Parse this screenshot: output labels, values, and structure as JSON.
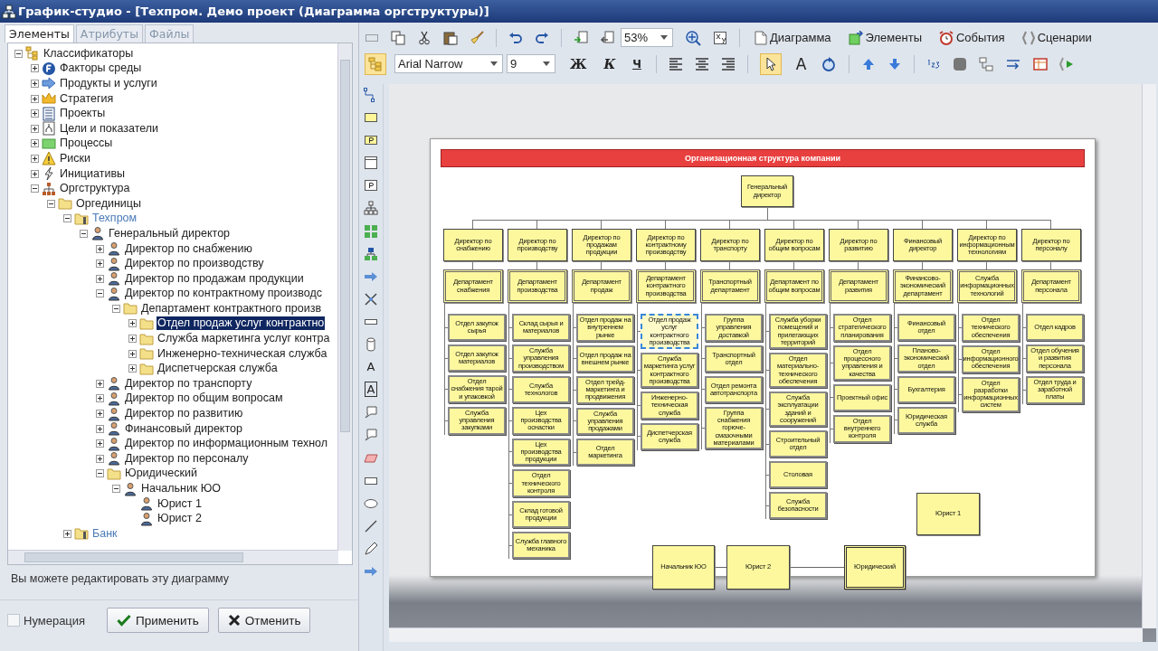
{
  "window": {
    "title": "График-студио - [Техпром. Демо проект (Диаграмма оргструктуры)]"
  },
  "left_panel": {
    "tabs": [
      {
        "label": "Элементы",
        "selected": true
      },
      {
        "label": "Атрибуты",
        "selected": false
      },
      {
        "label": "Файлы",
        "selected": false
      }
    ],
    "tree": [
      {
        "label": "Классификаторы",
        "kind": "classifier",
        "expanded": true,
        "selected": false,
        "children": [
          {
            "label": "Факторы среды",
            "kind": "factor",
            "expanded": false,
            "selected": false
          },
          {
            "label": "Продукты и услуги",
            "kind": "product",
            "expanded": false,
            "selected": false
          },
          {
            "label": "Стратегия",
            "kind": "strategy",
            "expanded": false,
            "selected": false
          },
          {
            "label": "Проекты",
            "kind": "project",
            "expanded": false,
            "selected": false
          },
          {
            "label": "Цели и показатели",
            "kind": "goal",
            "expanded": false,
            "selected": false
          },
          {
            "label": "Процессы",
            "kind": "process",
            "expanded": false,
            "selected": false
          },
          {
            "label": "Риски",
            "kind": "risk",
            "expanded": false,
            "selected": false
          },
          {
            "label": "Инициативы",
            "kind": "initiative",
            "expanded": false,
            "selected": false
          },
          {
            "label": "Оргструктура",
            "kind": "org",
            "expanded": true,
            "selected": false,
            "children": [
              {
                "label": "Оргединицы",
                "kind": "folder",
                "expanded": true,
                "selected": false,
                "children": [
                  {
                    "label": "Техпром",
                    "kind": "company",
                    "expanded": true,
                    "selected": false,
                    "children": [
                      {
                        "label": "Генеральный директор",
                        "kind": "person",
                        "expanded": true,
                        "selected": false,
                        "children": [
                          {
                            "label": "Директор по снабжению",
                            "kind": "person",
                            "expanded": false,
                            "selected": false
                          },
                          {
                            "label": "Директор по производству",
                            "kind": "person",
                            "expanded": false,
                            "selected": false
                          },
                          {
                            "label": "Директор по продажам продукции",
                            "kind": "person",
                            "expanded": false,
                            "selected": false
                          },
                          {
                            "label": "Директор по контрактному производс",
                            "kind": "person",
                            "expanded": true,
                            "selected": false,
                            "children": [
                              {
                                "label": "Департамент контрактного произв",
                                "kind": "folder",
                                "expanded": true,
                                "selected": false,
                                "children": [
                                  {
                                    "label": "Отдел продаж услуг контрактно",
                                    "kind": "folder",
                                    "expanded": false,
                                    "selected": true
                                  },
                                  {
                                    "label": "Служба маркетинга услуг контра",
                                    "kind": "folder",
                                    "expanded": false,
                                    "selected": false
                                  },
                                  {
                                    "label": "Инженерно-техническая служба",
                                    "kind": "folder",
                                    "expanded": false,
                                    "selected": false
                                  },
                                  {
                                    "label": "Диспетчерская служба",
                                    "kind": "folder",
                                    "expanded": false,
                                    "selected": false
                                  }
                                ]
                              }
                            ]
                          },
                          {
                            "label": "Директор по транспорту",
                            "kind": "person",
                            "expanded": false,
                            "selected": false
                          },
                          {
                            "label": "Директор по общим вопросам",
                            "kind": "person",
                            "expanded": false,
                            "selected": false
                          },
                          {
                            "label": "Директор по развитию",
                            "kind": "person",
                            "expanded": false,
                            "selected": false
                          },
                          {
                            "label": "Финансовый директор",
                            "kind": "person",
                            "expanded": false,
                            "selected": false
                          },
                          {
                            "label": "Директор по информационным технол",
                            "kind": "person",
                            "expanded": false,
                            "selected": false
                          },
                          {
                            "label": "Директор по персоналу",
                            "kind": "person",
                            "expanded": false,
                            "selected": false
                          },
                          {
                            "label": "Юридический",
                            "kind": "folder",
                            "expanded": true,
                            "selected": false,
                            "children": [
                              {
                                "label": "Начальник ЮО",
                                "kind": "person",
                                "expanded": true,
                                "selected": false,
                                "children": [
                                  {
                                    "label": "Юрист 1",
                                    "kind": "person",
                                    "selected": false
                                  },
                                  {
                                    "label": "Юрист 2",
                                    "kind": "person",
                                    "selected": false
                                  }
                                ]
                              }
                            ]
                          }
                        ]
                      }
                    ]
                  },
                  {
                    "label": "Банк",
                    "kind": "company",
                    "expanded": false,
                    "selected": false
                  }
                ]
              }
            ]
          }
        ]
      }
    ],
    "status_text": "Вы можете редактировать эту диаграмму",
    "numbering": {
      "label": "Нумерация",
      "checked": false
    },
    "buttons": [
      {
        "label": "Применить",
        "kind": "apply"
      },
      {
        "label": "Отменить",
        "kind": "cancel"
      }
    ]
  },
  "toolbar": {
    "zoom": "53%",
    "font": "Arial Narrow",
    "font_size": "9",
    "format_buttons": [
      "Ж",
      "К",
      "Ч"
    ],
    "text_tool": "A",
    "tree_toggle_on": true,
    "pointer_selected": true,
    "view_buttons": [
      {
        "label": "Диаграмма",
        "kind": "diagram"
      },
      {
        "label": "Элементы",
        "kind": "elements"
      },
      {
        "label": "События",
        "kind": "events"
      },
      {
        "label": "Сценарии",
        "kind": "scenarios"
      }
    ]
  },
  "palette": [
    {
      "kind": "connector"
    },
    {
      "kind": "rect-fill"
    },
    {
      "kind": "p-fill"
    },
    {
      "kind": "frame"
    },
    {
      "kind": "p-frame"
    },
    {
      "kind": "org"
    },
    {
      "kind": "grid"
    },
    {
      "kind": "org-color"
    },
    {
      "kind": "arrow"
    },
    {
      "kind": "cross"
    },
    {
      "kind": "bar"
    },
    {
      "kind": "cylinder"
    },
    {
      "kind": "text",
      "label": "A"
    },
    {
      "kind": "text-box",
      "label": "A"
    },
    {
      "kind": "callout"
    },
    {
      "kind": "callout"
    },
    {
      "kind": "parallelogram"
    },
    {
      "kind": "rect"
    },
    {
      "kind": "ellipse"
    },
    {
      "kind": "line"
    },
    {
      "kind": "pen"
    },
    {
      "kind": "arrow"
    }
  ],
  "diagram": {
    "title": "Организационная структура компании",
    "root": "Генеральный директор",
    "branches": [
      {
        "director": "Директор по снабжению",
        "department": "Департамент снабжения",
        "units": [
          {
            "name": "Отдел закупок сырья",
            "selected": false
          },
          {
            "name": "Отдел закупок материалов",
            "selected": false
          },
          {
            "name": "Отдел снабжения тарой и упаковкой",
            "selected": false
          },
          {
            "name": "Служба управления закупками",
            "selected": false
          }
        ]
      },
      {
        "director": "Директор по производству",
        "department": "Департамент производства",
        "units": [
          {
            "name": "Склад сырья и материалов",
            "selected": false
          },
          {
            "name": "Служба управления производством",
            "selected": false
          },
          {
            "name": "Служба технологов",
            "selected": false
          },
          {
            "name": "Цех производства оснастки",
            "selected": false
          },
          {
            "name": "Цех производства продукции",
            "selected": false
          },
          {
            "name": "Отдел технического контроля",
            "selected": false
          },
          {
            "name": "Склад готовой продукции",
            "selected": false
          },
          {
            "name": "Служба главного механика",
            "selected": false
          }
        ]
      },
      {
        "director": "Директор по продажам продукции",
        "department": "Департамент продаж",
        "units": [
          {
            "name": "Отдел продаж на внутреннем рынке",
            "selected": false
          },
          {
            "name": "Отдел продаж на внешнем рынке",
            "selected": false
          },
          {
            "name": "Отдел трейд-маркетинга и продвижения",
            "selected": false
          },
          {
            "name": "Служба управления продажами",
            "selected": false
          },
          {
            "name": "Отдел маркетинга",
            "selected": false
          }
        ]
      },
      {
        "director": "Директор по контрактному производству",
        "department": "Департамент контрактного производства",
        "units": [
          {
            "name": "Отдел продаж услуг контрактного производства",
            "selected": true
          },
          {
            "name": "Служба маркетинга услуг контрактного производства",
            "selected": false
          },
          {
            "name": "Инженерно-техническая служба",
            "selected": false
          },
          {
            "name": "Диспетчерская служба",
            "selected": false
          }
        ]
      },
      {
        "director": "Директор по транспорту",
        "department": "Транспортный департамент",
        "units": [
          {
            "name": "Группа управления доставкой",
            "selected": false
          },
          {
            "name": "Транспортный отдел",
            "selected": false
          },
          {
            "name": "Отдел ремонта автотранспорта",
            "selected": false
          },
          {
            "name": "Группа снабжения горюче-смазочными материалами",
            "selected": false
          }
        ]
      },
      {
        "director": "Директор по общим вопросам",
        "department": "Департамент по общим вопросам",
        "units": [
          {
            "name": "Служба уборки помещений и прилегающих территорий",
            "selected": false
          },
          {
            "name": "Отдел материально-технического обеспечения",
            "selected": false
          },
          {
            "name": "Служба эксплуатации зданий и сооружений",
            "selected": false
          },
          {
            "name": "Строительный отдел",
            "selected": false
          },
          {
            "name": "Столовая",
            "selected": false
          },
          {
            "name": "Служба безопасности",
            "selected": false
          }
        ]
      },
      {
        "director": "Директор по развитию",
        "department": "Департамент развития",
        "units": [
          {
            "name": "Отдел стратегического планирования",
            "selected": false
          },
          {
            "name": "Отдел процессного управления и качества",
            "selected": false
          },
          {
            "name": "Проектный офис",
            "selected": false
          },
          {
            "name": "Отдел внутреннего контроля",
            "selected": false
          }
        ]
      },
      {
        "director": "Финансовый директор",
        "department": "Финансово-экономический департамент",
        "units": [
          {
            "name": "Финансовый отдел",
            "selected": false
          },
          {
            "name": "Планово-экономический отдел",
            "selected": false
          },
          {
            "name": "Бухгалтерия",
            "selected": false
          },
          {
            "name": "Юридическая служба",
            "selected": false
          }
        ]
      },
      {
        "director": "Директор по информационным технологиям",
        "department": "Служба информационных технологий",
        "units": [
          {
            "name": "Отдел технического обеспечения",
            "selected": false
          },
          {
            "name": "Отдел информационного обеспечения",
            "selected": false
          },
          {
            "name": "Отдел разработки информационных систем",
            "selected": false
          }
        ]
      },
      {
        "director": "Директор по персоналу",
        "department": "Департамент персонала",
        "units": [
          {
            "name": "Отдел кадров",
            "selected": false
          },
          {
            "name": "Отдел обучения и развития персонала",
            "selected": false
          },
          {
            "name": "Отдел труда и заработной платы",
            "selected": false
          }
        ]
      }
    ],
    "floating": [
      {
        "name": "Юрист 1",
        "kind": "plain"
      },
      {
        "name": "Начальник ЮО",
        "kind": "plain"
      },
      {
        "name": "Юрист 2",
        "kind": "plain"
      },
      {
        "name": "Юридический",
        "kind": "double"
      }
    ]
  }
}
